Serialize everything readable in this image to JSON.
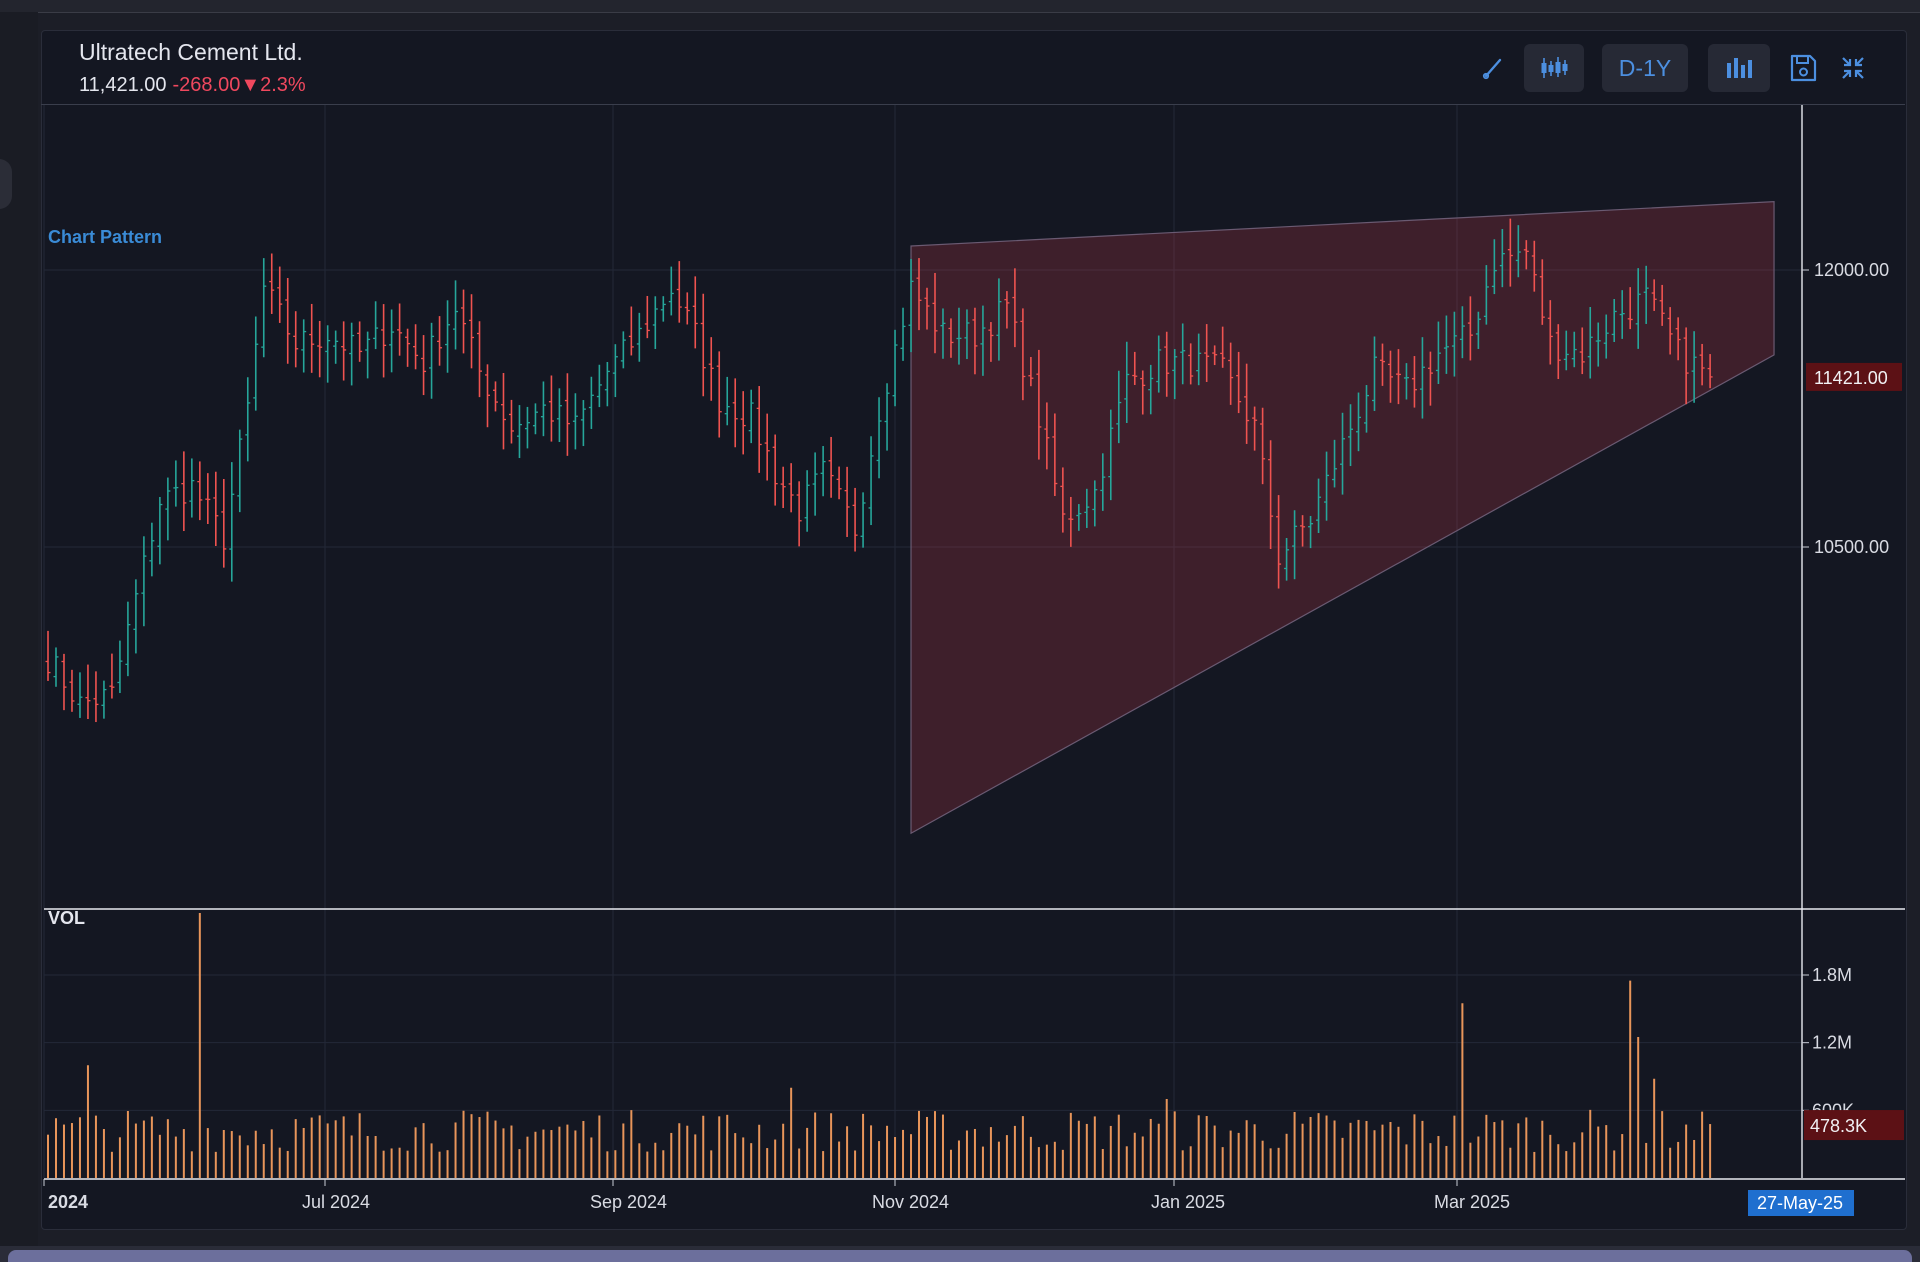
{
  "header": {
    "title": "Ultratech Cement Ltd.",
    "price": "11,421.00",
    "change": "-268.00▼2.3%"
  },
  "toolbar": {
    "draw_icon": "pen-line-icon",
    "candles_icon": "candlestick-icon",
    "period_label": "D-1Y",
    "bars_icon": "volume-bars-icon",
    "save_icon": "floppy-disk-icon",
    "collapse_icon": "collapse-arrows-icon",
    "accent_color": "#4c8fe0"
  },
  "annotations": {
    "pattern_label": "Chart Pattern",
    "volume_label": "VOL",
    "pattern_type": "rising wedge",
    "pattern_fill": "#c33a4a"
  },
  "chart_data": [
    {
      "type": "ohlc",
      "title": "",
      "interval": "D",
      "range": "1Y",
      "x_ticks": [
        "2024",
        "Jul 2024",
        "Sep 2024",
        "Nov 2024",
        "Jan 2025",
        "Mar 2025"
      ],
      "last_date_label": "27-May-25",
      "y_ticks": [
        "12000.00",
        "10500.00"
      ],
      "y_tick_values": [
        12000,
        10500
      ],
      "last_price_label": "11421.00",
      "last_price": 11421,
      "up_color": "#26a69a",
      "down_color": "#ef5350",
      "grid": true,
      "wedge_top_start": {
        "x_index": 108,
        "price": 12130
      },
      "wedge_top_end": {
        "x_index": 216,
        "price": 12370
      },
      "wedge_bottom_start": {
        "x_index": 108,
        "price": 8950
      },
      "wedge_bottom_end": {
        "x_index": 216,
        "price": 11540
      },
      "close_anchors": [
        [
          0,
          9900
        ],
        [
          4,
          9650
        ],
        [
          8,
          9700
        ],
        [
          10,
          10050
        ],
        [
          14,
          10750
        ],
        [
          18,
          10830
        ],
        [
          22,
          10550
        ],
        [
          25,
          11250
        ],
        [
          27,
          11900
        ],
        [
          31,
          11600
        ],
        [
          35,
          11650
        ],
        [
          39,
          11550
        ],
        [
          43,
          11700
        ],
        [
          47,
          11500
        ],
        [
          51,
          11800
        ],
        [
          54,
          11450
        ],
        [
          58,
          11150
        ],
        [
          62,
          11250
        ],
        [
          66,
          11150
        ],
        [
          70,
          11450
        ],
        [
          74,
          11650
        ],
        [
          78,
          11900
        ],
        [
          81,
          11650
        ],
        [
          84,
          11300
        ],
        [
          88,
          11200
        ],
        [
          91,
          10900
        ],
        [
          94,
          10700
        ],
        [
          97,
          10900
        ],
        [
          101,
          10600
        ],
        [
          104,
          11250
        ],
        [
          108,
          11900
        ],
        [
          112,
          11650
        ],
        [
          116,
          11650
        ],
        [
          120,
          11800
        ],
        [
          124,
          11200
        ],
        [
          127,
          10650
        ],
        [
          131,
          10800
        ],
        [
          135,
          11400
        ],
        [
          139,
          11500
        ],
        [
          143,
          11500
        ],
        [
          147,
          11450
        ],
        [
          151,
          11150
        ],
        [
          154,
          10450
        ],
        [
          158,
          10650
        ],
        [
          162,
          11050
        ],
        [
          166,
          11450
        ],
        [
          170,
          11350
        ],
        [
          174,
          11550
        ],
        [
          178,
          11650
        ],
        [
          181,
          12050
        ],
        [
          185,
          12100
        ],
        [
          188,
          11600
        ],
        [
          192,
          11550
        ],
        [
          196,
          11750
        ],
        [
          200,
          11850
        ],
        [
          204,
          11550
        ],
        [
          208,
          11421
        ]
      ]
    },
    {
      "type": "bar",
      "title": "VOL",
      "y_ticks": [
        "1.8M",
        "1.2M",
        "600K"
      ],
      "y_tick_values": [
        1800000,
        1200000,
        600000
      ],
      "last_volume_label": "478.3K",
      "last_volume": 478300,
      "bar_color": "#e8955a",
      "baseline_volume": 420000,
      "spikes": [
        [
          5,
          1000000
        ],
        [
          19,
          2350000
        ],
        [
          93,
          800000
        ],
        [
          140,
          700000
        ],
        [
          177,
          1550000
        ],
        [
          198,
          1750000
        ],
        [
          199,
          1250000
        ],
        [
          201,
          880000
        ]
      ]
    }
  ]
}
